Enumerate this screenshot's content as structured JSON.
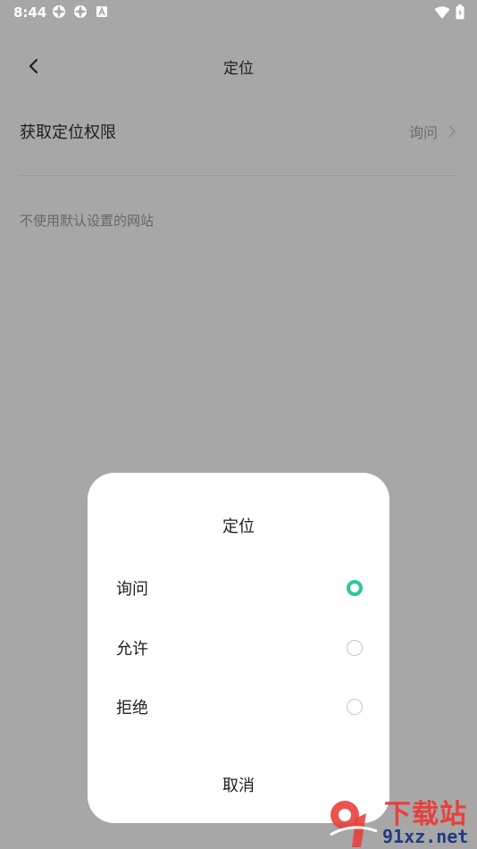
{
  "status_bar": {
    "time": "8:44",
    "icons": [
      "app-notification-icon",
      "app-notification-icon",
      "a-box-icon"
    ],
    "right_icons": [
      "wifi-icon",
      "battery-icon"
    ]
  },
  "header": {
    "title": "定位"
  },
  "settings": {
    "permission_row": {
      "label": "获取定位权限",
      "value": "询问"
    },
    "section_label": "不使用默认设置的网站"
  },
  "dialog": {
    "title": "定位",
    "options": [
      {
        "label": "询问",
        "selected": true
      },
      {
        "label": "允许",
        "selected": false
      },
      {
        "label": "拒绝",
        "selected": false
      }
    ],
    "cancel_label": "取消"
  },
  "watermark": {
    "cn_text": "下载站",
    "url_text": "91xz.net"
  },
  "colors": {
    "accent": "#2fc69a",
    "scrim": "#a7a7a7"
  }
}
